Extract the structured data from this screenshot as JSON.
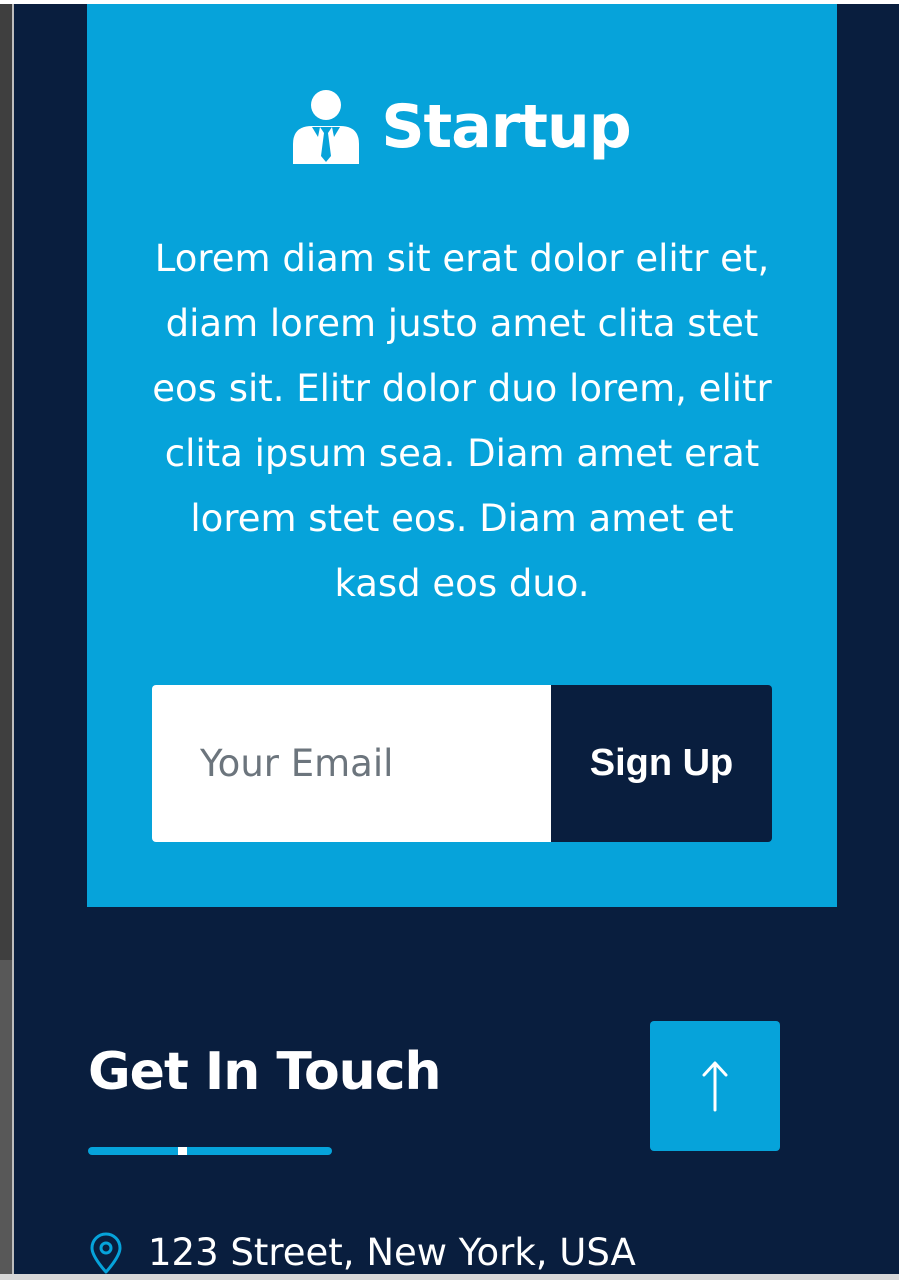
{
  "brand": {
    "name": "Startup",
    "icon": "user-tie-icon"
  },
  "promo": {
    "text": "Lorem diam sit erat dolor elitr et, diam lorem justo amet clita stet eos sit. Elitr dolor duo lorem, elitr clita ipsum sea. Diam amet erat lorem stet eos. Diam amet et kasd eos duo."
  },
  "newsletter": {
    "email_placeholder": "Your Email",
    "email_value": "",
    "button_label": "Sign Up"
  },
  "contact": {
    "heading": "Get In Touch",
    "address_icon": "map-marker-icon",
    "address": "123 Street, New York, USA"
  },
  "back_to_top": {
    "icon": "arrow-up-icon"
  },
  "colors": {
    "primary": "#06A3DA",
    "dark": "#091E3E",
    "text_light": "#FFFFFF",
    "placeholder": "#6C757D"
  }
}
